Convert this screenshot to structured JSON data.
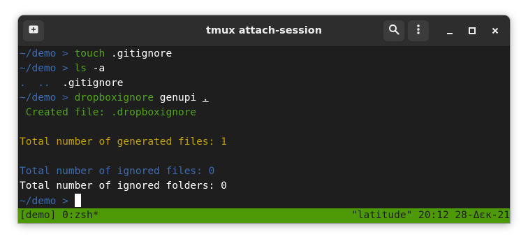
{
  "window": {
    "title": "tmux attach-session"
  },
  "titlebar": {
    "new_tab_icon": "new-tab-icon",
    "search_icon": "search-icon",
    "menu_icon": "kebab-menu-icon",
    "minimize_icon": "minimize-icon",
    "maximize_icon": "maximize-icon",
    "close_icon": "close-icon"
  },
  "terminal": {
    "lines": [
      {
        "prompt": "~/demo > ",
        "cmd": "touch",
        "args": " .gitignore"
      },
      {
        "prompt": "~/demo > ",
        "cmd": "ls",
        "args": " -a"
      },
      {
        "dots": ".  .. ",
        "file": " .gitignore"
      },
      {
        "prompt": "~/demo > ",
        "cmd": "dropboxignore",
        "args": " genupi ",
        "underlined": "."
      },
      {
        "text": " Created file: .dropboxignore"
      },
      {
        "text": ""
      },
      {
        "text": "Total number of generated files: 1"
      },
      {
        "text": ""
      },
      {
        "text": "Total number of ignored files: 0"
      },
      {
        "text": "Total number of ignored folders: 0"
      },
      {
        "prompt": "~/demo > "
      }
    ]
  },
  "status": {
    "left": "[demo] 0:zsh*",
    "right": "\"latitude\" 20:12 28-Δεκ-21"
  },
  "colors": {
    "path": "#3d6bb0",
    "command": "#52a21f",
    "yellow": "#c4a000",
    "status_bg": "#4e9a06",
    "terminal_bg": "#1e1e1e",
    "titlebar_bg": "#2d2d2d"
  }
}
